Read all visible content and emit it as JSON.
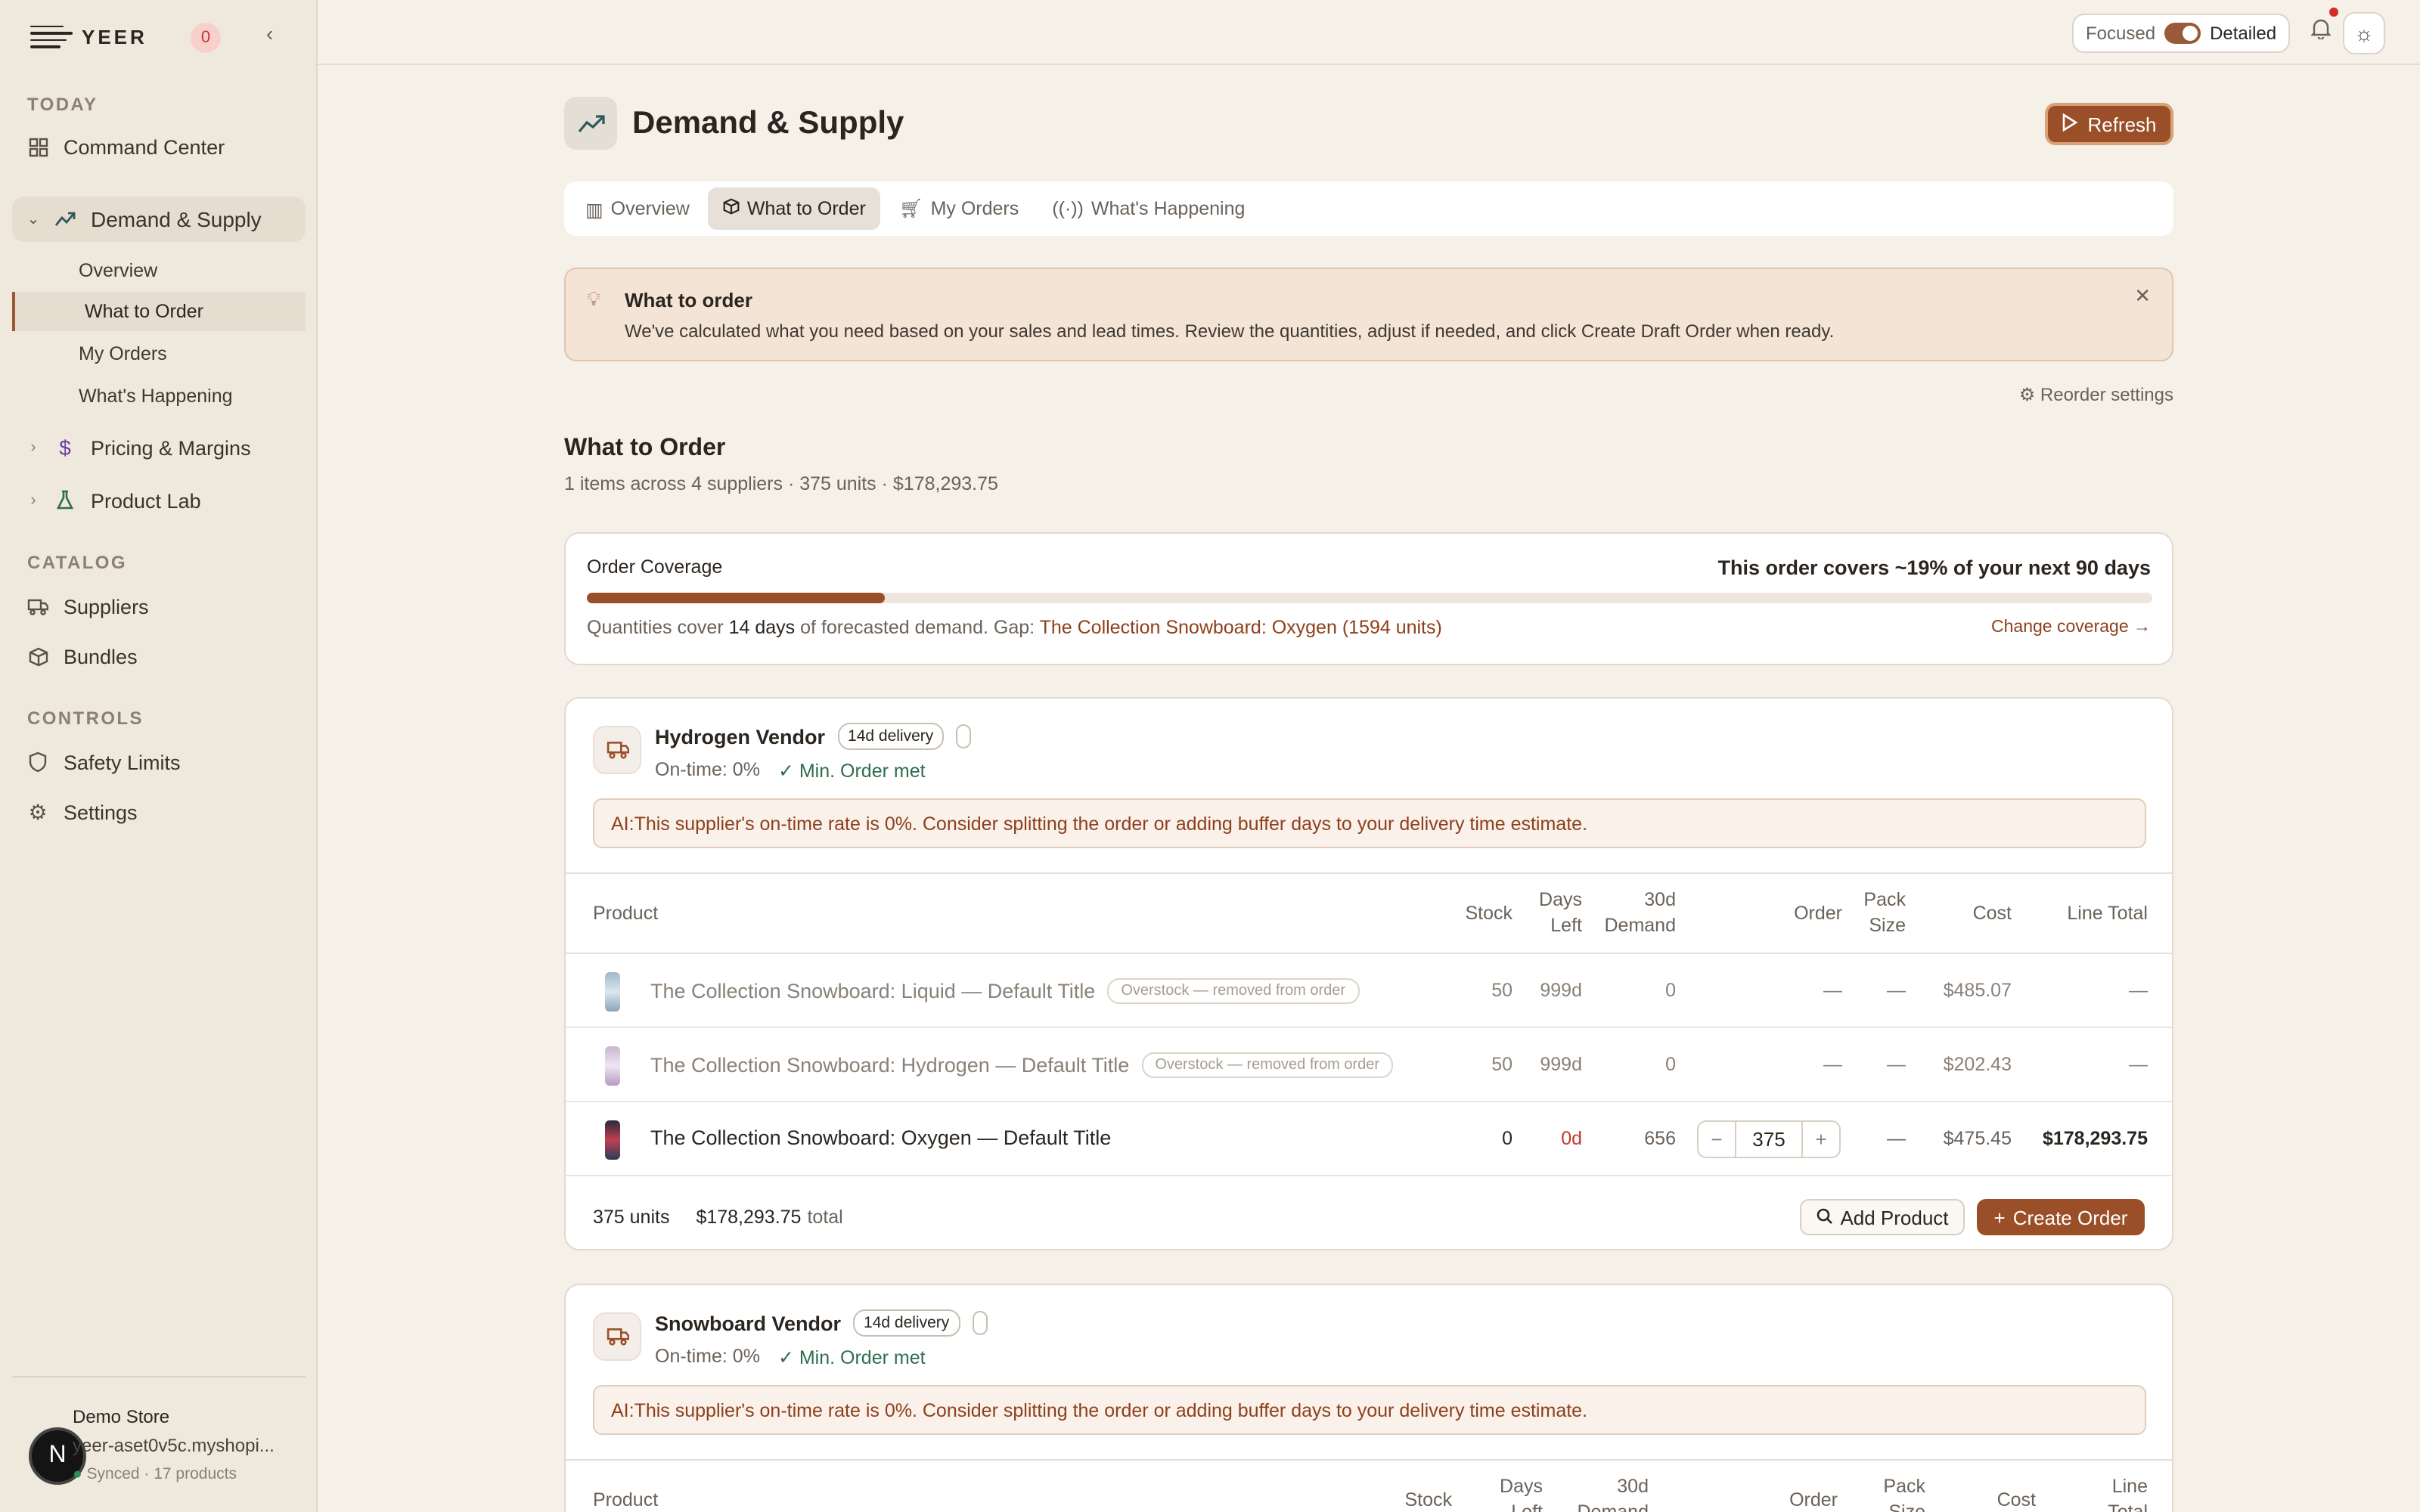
{
  "brand": {
    "name": "YEER",
    "notif_count": "0"
  },
  "sidebar": {
    "sec_today": "TODAY",
    "command_center": "Command Center",
    "demand_supply": "Demand & Supply",
    "subs": [
      "Overview",
      "What to Order",
      "My Orders",
      "What's Happening"
    ],
    "pricing": "Pricing & Margins",
    "product_lab": "Product Lab",
    "sec_catalog": "CATALOG",
    "suppliers": "Suppliers",
    "bundles": "Bundles",
    "sec_controls": "CONTROLS",
    "safety": "Safety Limits",
    "settings": "Settings",
    "store": {
      "name": "Demo Store",
      "url": "yeer-aset0v5c.myshopi...",
      "status": "Synced · 17 products",
      "avatar": "N"
    }
  },
  "topbar": {
    "focused": "Focused",
    "detailed": "Detailed"
  },
  "page": {
    "title": "Demand & Supply",
    "refresh": "Refresh",
    "tabs": [
      "Overview",
      "What to Order",
      "My Orders",
      "What's Happening"
    ],
    "tip": {
      "title": "What to order",
      "desc": "We've calculated what you need based on your sales and lead times. Review the quantities, adjust if needed, and click Create Draft Order when ready."
    },
    "reorder_settings": "⚙ Reorder settings",
    "section_title": "What to Order",
    "section_sub": "1 items across 4 suppliers · 375 units · $178,293.75",
    "coverage": {
      "label": "Order Coverage",
      "headline": "This order covers ~19% of your next 90 days",
      "percent": 19,
      "note_a": "Quantities cover",
      "note_days": "14 days",
      "note_b": "of forecasted demand. Gap:",
      "note_gap": "The Collection Snowboard: Oxygen (1594 units)",
      "change": "Change coverage →"
    }
  },
  "columns": {
    "product": "Product",
    "stock": "Stock",
    "days_a": "Days",
    "days_b": "Left",
    "dem_a": "30d",
    "dem_b": "Demand",
    "order": "Order",
    "pack_a": "Pack",
    "pack_b": "Size",
    "cost": "Cost",
    "total": "Line Total",
    "total_a": "Line",
    "total_b": "Total"
  },
  "vendors": [
    {
      "name": "Hydrogen Vendor",
      "delivery": "14d delivery",
      "ontime": "On-time: 0%",
      "moq": "Min. Order met",
      "ai": "AI:This supplier's on-time rate is 0%. Consider splitting the order or adding buffer days to your delivery time estimate.",
      "rows": [
        {
          "name": "The Collection Snowboard: Liquid — Default Title",
          "flag": "Overstock — removed from order",
          "stock": "50",
          "days": "999d",
          "demand": "0",
          "order": "—",
          "pack": "—",
          "cost": "$485.07",
          "total": "—"
        },
        {
          "name": "The Collection Snowboard: Hydrogen — Default Title",
          "flag": "Overstock — removed from order",
          "stock": "50",
          "days": "999d",
          "demand": "0",
          "order": "—",
          "pack": "—",
          "cost": "$202.43",
          "total": "—"
        },
        {
          "name": "The Collection Snowboard: Oxygen — Default Title",
          "stock": "0",
          "days": "0d",
          "demand": "656",
          "qty": "375",
          "pack": "—",
          "cost": "$475.45",
          "total": "$178,293.75"
        }
      ],
      "units": "375 units",
      "total": "$178,293.75",
      "total_suffix": "total",
      "add": "Add Product",
      "create": "Create Order"
    },
    {
      "name": "Snowboard Vendor",
      "delivery": "14d delivery",
      "ontime": "On-time: 0%",
      "moq": "Min. Order met",
      "ai": "AI:This supplier's on-time rate is 0%. Consider splitting the order or adding buffer days to your delivery time estimate."
    }
  ],
  "colors": {
    "accent": "#9a4f29",
    "bg": "#f5f0e8",
    "sidebar": "#efe8dd"
  }
}
